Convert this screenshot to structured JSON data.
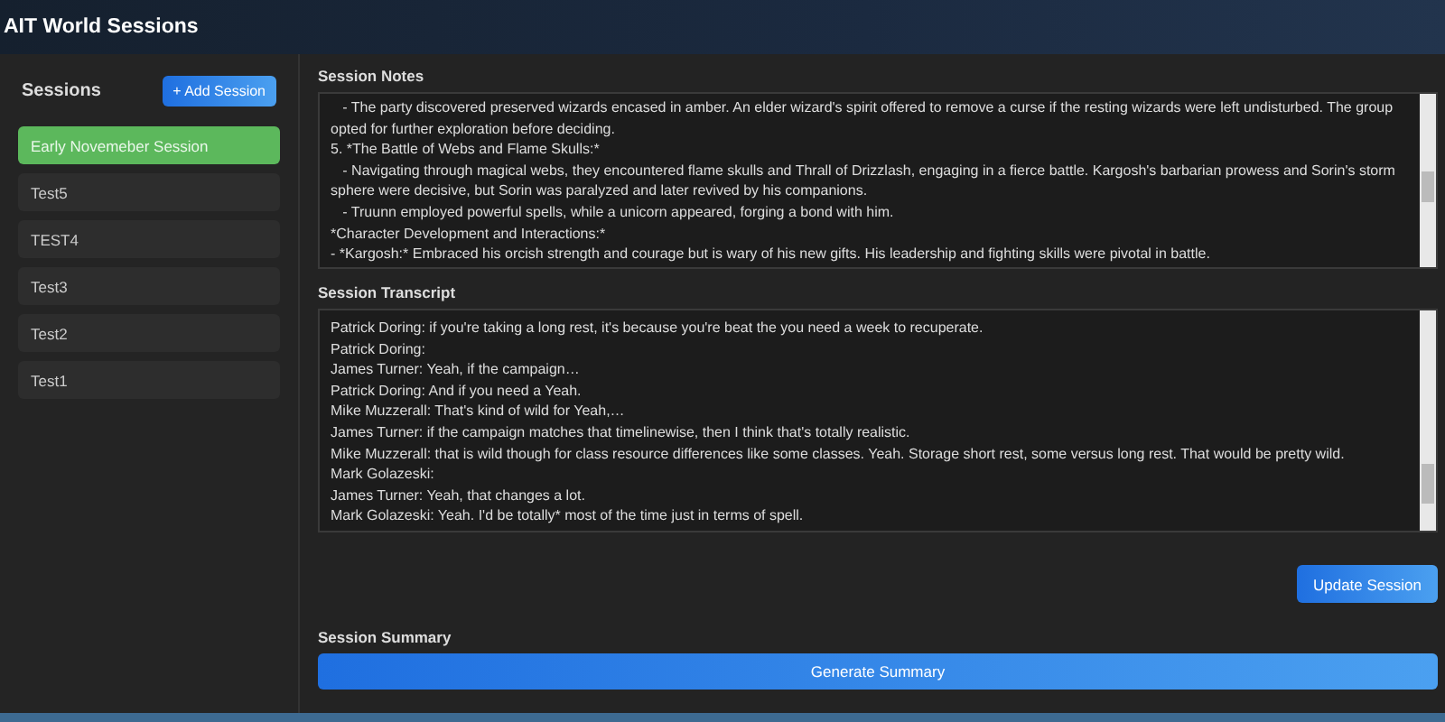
{
  "app_title": "AIT World Sessions",
  "sidebar": {
    "title": "Sessions",
    "add_button": "+ Add Session",
    "items": [
      {
        "label": "Early Novemeber Session",
        "selected": true
      },
      {
        "label": "Test5",
        "selected": false
      },
      {
        "label": "TEST4",
        "selected": false
      },
      {
        "label": "Test3",
        "selected": false
      },
      {
        "label": "Test2",
        "selected": false
      },
      {
        "label": "Test1",
        "selected": false
      }
    ]
  },
  "notes": {
    "label": "Session Notes",
    "lines": [
      "   - The party discovered preserved wizards encased in amber. An elder wizard's spirit offered to remove a curse if the resting wizards were left undisturbed. The group opted for further exploration before deciding.",
      "5. *The Battle of Webs and Flame Skulls:*",
      "   - Navigating through magical webs, they encountered flame skulls and Thrall of Drizzlash, engaging in a fierce battle. Kargosh's barbarian prowess and Sorin's storm sphere were decisive, but Sorin was paralyzed and later revived by his companions.",
      "   - Truunn employed powerful spells, while a unicorn appeared, forging a bond with him.",
      "*Character Development and Interactions:*",
      "- *Kargosh:* Embraced his orcish strength and courage but is wary of his new gifts. His leadership and fighting skills were pivotal in battle."
    ]
  },
  "transcript": {
    "label": "Session Transcript",
    "lines": [
      "Patrick Doring: if you're taking a long rest, it's because you're beat the you need a week to recuperate.",
      "Patrick Doring:",
      "James Turner: Yeah, if the campaign…",
      "Patrick Doring: And if you need a Yeah.",
      "Mike Muzzerall: That's kind of wild for Yeah,…",
      "James Turner: if the campaign matches that timelinewise, then I think that's totally realistic.",
      "Mike Muzzerall: that is wild though for class resource differences like some classes. Yeah. Storage short rest, some versus long rest. That would be pretty wild.",
      "Mark Golazeski:",
      "James Turner: Yeah, that changes a lot.",
      "Mark Golazeski: Yeah. I'd be totally* most of the time just in terms of spell."
    ]
  },
  "update_button": "Update Session",
  "summary": {
    "label": "Session Summary",
    "button": "Generate Summary"
  }
}
